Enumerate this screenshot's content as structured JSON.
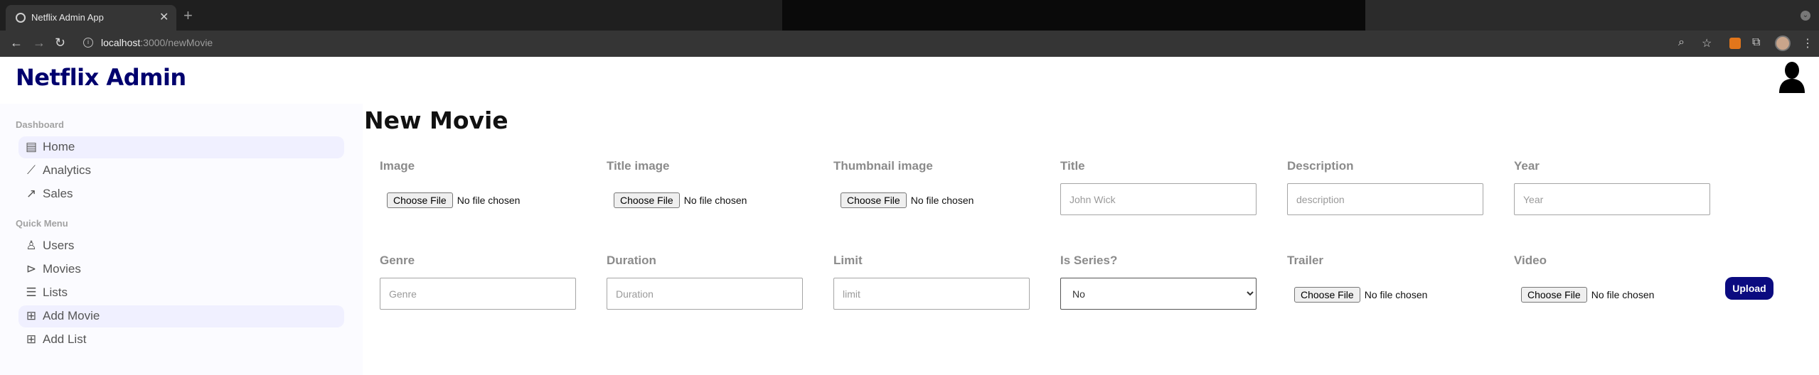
{
  "browser": {
    "tab_title": "Netflix Admin App",
    "tab_close": "✕",
    "new_tab": "+",
    "url_host": "localhost",
    "url_path": ":3000/newMovie"
  },
  "app": {
    "logo": "Netflix Admin"
  },
  "sidebar": {
    "sections": [
      {
        "title": "Dashboard",
        "items": [
          {
            "label": "Home",
            "icon": "home-grid-icon",
            "active": true
          },
          {
            "label": "Analytics",
            "icon": "timeline-icon",
            "active": false
          },
          {
            "label": "Sales",
            "icon": "trending-up-icon",
            "active": false
          }
        ]
      },
      {
        "title": "Quick Menu",
        "items": [
          {
            "label": "Users",
            "icon": "user-icon",
            "active": false
          },
          {
            "label": "Movies",
            "icon": "play-circle-icon",
            "active": false
          },
          {
            "label": "Lists",
            "icon": "list-icon",
            "active": false
          },
          {
            "label": "Add Movie",
            "icon": "add-to-queue-icon",
            "active": true
          },
          {
            "label": "Add List",
            "icon": "add-list-icon",
            "active": false
          }
        ]
      }
    ]
  },
  "main": {
    "title": "New Movie",
    "fields": {
      "image": {
        "label": "Image",
        "button": "Choose File",
        "status": "No file chosen"
      },
      "title_image": {
        "label": "Title image",
        "button": "Choose File",
        "status": "No file chosen"
      },
      "thumbnail_image": {
        "label": "Thumbnail image",
        "button": "Choose File",
        "status": "No file chosen"
      },
      "title": {
        "label": "Title",
        "placeholder": "John Wick",
        "value": ""
      },
      "description": {
        "label": "Description",
        "placeholder": "description",
        "value": ""
      },
      "year": {
        "label": "Year",
        "placeholder": "Year",
        "value": ""
      },
      "genre": {
        "label": "Genre",
        "placeholder": "Genre",
        "value": ""
      },
      "duration": {
        "label": "Duration",
        "placeholder": "Duration",
        "value": ""
      },
      "limit": {
        "label": "Limit",
        "placeholder": "limit",
        "value": ""
      },
      "is_series": {
        "label": "Is Series?",
        "selected": "No"
      },
      "trailer": {
        "label": "Trailer",
        "button": "Choose File",
        "status": "No file chosen"
      },
      "video": {
        "label": "Video",
        "button": "Choose File",
        "status": "No file chosen"
      }
    },
    "upload_button": "Upload"
  },
  "colors": {
    "brand": "#00006e",
    "upload_button": "#0b0b80",
    "sidebar_bg": "#fbfbff",
    "active_item_bg": "#f0f0ff"
  }
}
